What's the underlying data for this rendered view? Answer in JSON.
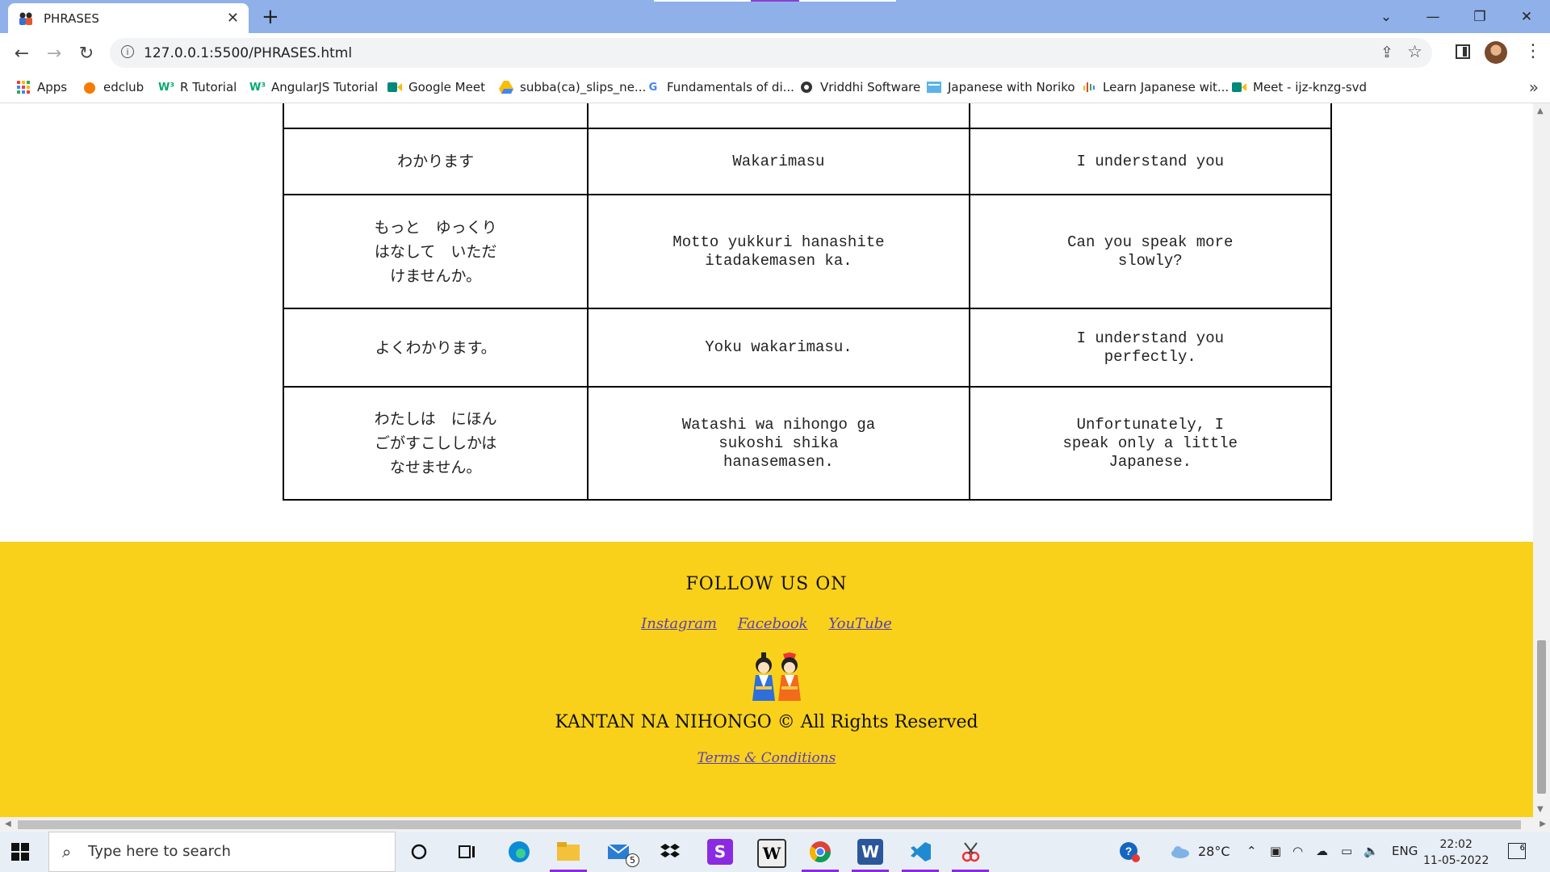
{
  "browser": {
    "tab_title": "PHRASES",
    "tab_close": "✕",
    "new_tab": "+",
    "url": "127.0.0.1:5500/PHRASES.html",
    "window_controls": [
      "⌄",
      "—",
      "❐",
      "✕"
    ],
    "bookmarks": [
      {
        "label": "Apps",
        "icon": "apps-grid-icon",
        "color": "#e94235"
      },
      {
        "label": "edclub",
        "icon": "edclub-icon",
        "color": "#f57c00"
      },
      {
        "label": "R Tutorial",
        "icon": "w3-icon",
        "color": "#04aa6d"
      },
      {
        "label": "AngularJS Tutorial",
        "icon": "w3-icon",
        "color": "#04aa6d"
      },
      {
        "label": "Google Meet",
        "icon": "google-meet-icon",
        "color": "#00897b"
      },
      {
        "label": "subba(ca)_slips_ne...",
        "icon": "google-drive-icon",
        "color": "#fbbc04"
      },
      {
        "label": "Fundamentals of di...",
        "icon": "google-icon",
        "color": "#4285f4"
      },
      {
        "label": "Vriddhi Software",
        "icon": "globe-icon",
        "color": "#333333"
      },
      {
        "label": "Japanese with Noriko",
        "icon": "page-icon",
        "color": "#5ab4e8"
      },
      {
        "label": "Learn Japanese wit...",
        "icon": "podcast-icon",
        "color": "#ea4335"
      },
      {
        "label": "Meet - ijz-knzg-svd",
        "icon": "google-meet-icon",
        "color": "#00897b"
      }
    ]
  },
  "table": {
    "rows": [
      {
        "jp": "",
        "romaji": "",
        "english": ""
      },
      {
        "jp": "わかります",
        "romaji": "Wakarimasu",
        "english": "I understand you"
      },
      {
        "jp": "もっと　ゆっくり　はなして　いただけませんか。",
        "romaji": "Motto yukkuri hanashite itadakemasen ka.",
        "english": "Can you speak more slowly?"
      },
      {
        "jp": "よくわかります。",
        "romaji": "Yoku wakarimasu.",
        "english": "I understand you perfectly."
      },
      {
        "jp": "わたしは　にほんごがすこししかはなせません。",
        "romaji": "Watashi wa nihongo ga sukoshi shika hanasemasen.",
        "english": "Unfortunately, I speak only a little Japanese."
      }
    ]
  },
  "footer": {
    "follow_heading": "FOLLOW US ON",
    "links": [
      "Instagram",
      "Facebook",
      "YouTube"
    ],
    "copyright": "KANTAN NA NIHONGO  © All Rights Reserved",
    "terms": "Terms & Conditions",
    "background": "#f9d11a"
  },
  "taskbar": {
    "search_placeholder": "Type here to search",
    "mail_badge": "5",
    "temperature": "28°C",
    "language": "ENG",
    "time": "22:02",
    "date": "11-05-2022",
    "notification_count": "6"
  }
}
